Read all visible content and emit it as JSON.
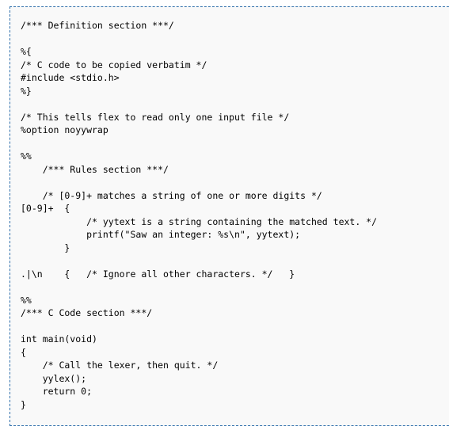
{
  "code_block": {
    "lines": [
      "/*** Definition section ***/",
      "",
      "%{",
      "/* C code to be copied verbatim */",
      "#include <stdio.h>",
      "%}",
      "",
      "/* This tells flex to read only one input file */",
      "%option noyywrap",
      "",
      "%%",
      "    /*** Rules section ***/",
      "",
      "    /* [0-9]+ matches a string of one or more digits */",
      "[0-9]+  {",
      "            /* yytext is a string containing the matched text. */",
      "            printf(\"Saw an integer: %s\\n\", yytext);",
      "        }",
      "",
      ".|\\n    {   /* Ignore all other characters. */   }",
      "",
      "%%",
      "/*** C Code section ***/",
      "",
      "int main(void)",
      "{",
      "    /* Call the lexer, then quit. */",
      "    yylex();",
      "    return 0;",
      "}"
    ]
  }
}
